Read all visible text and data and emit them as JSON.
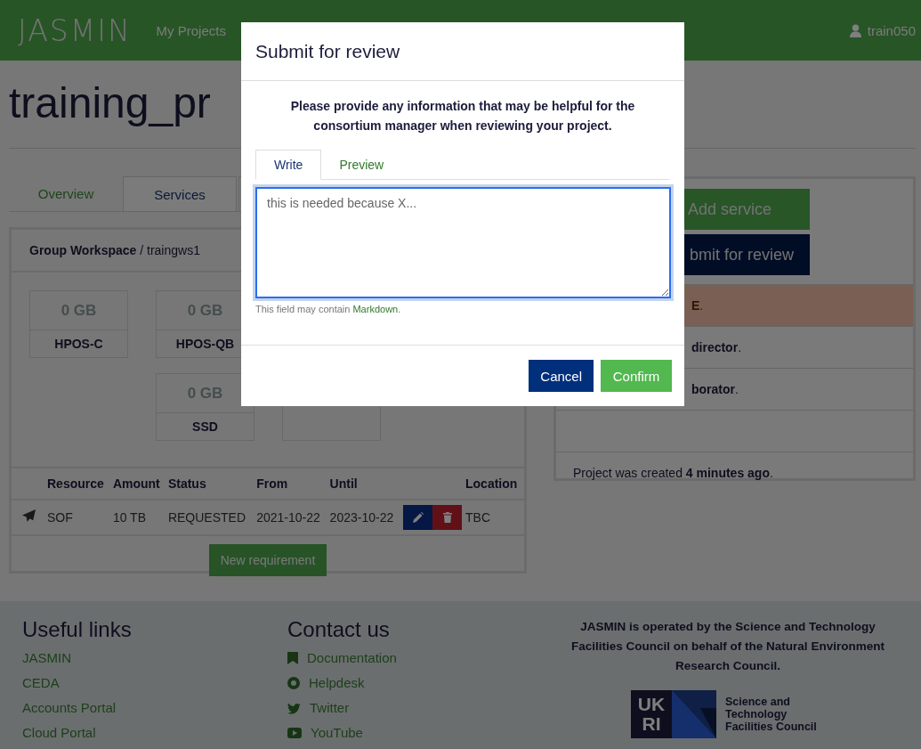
{
  "header": {
    "logo": "JASMIN",
    "nav": [
      {
        "label": "My Projects"
      }
    ],
    "user": "train050"
  },
  "project_title": "training_pr",
  "tabs": [
    {
      "label": "Overview",
      "selected": false
    },
    {
      "label": "Services",
      "selected": true
    }
  ],
  "service": {
    "heading": "**Group Workspace** / traingws1",
    "storage": [
      {
        "amount": "0 GB",
        "label": "HPOS-C"
      },
      {
        "amount": "0 GB",
        "label": "HPOS-QB"
      },
      {
        "amount": "0 GB",
        "label": "SSD"
      }
    ],
    "table": {
      "columns": [
        "Resource",
        "Amount",
        "Status",
        "From",
        "Until",
        "Location"
      ],
      "rows": [
        {
          "resource": "SOF",
          "amount": "10 TB",
          "status": "REQUESTED",
          "from": "2021-10-22",
          "until": "2023-10-22",
          "location": "TBC"
        }
      ]
    },
    "new_button": "New requirement"
  },
  "side_panel": {
    "buttons": [
      {
        "label": "Add service",
        "kind": "success"
      },
      {
        "label": "bmit for review",
        "kind": "primary"
      }
    ],
    "rows": [
      {
        "kind": "alert",
        "text": "**E**."
      },
      {
        "kind": "plain",
        "text": "**director**."
      },
      {
        "kind": "link",
        "text": "**borator**."
      },
      {
        "kind": "plain"
      },
      {
        "kind": "plain",
        "text": "Project was created **4 minutes ago**."
      }
    ]
  },
  "footer": {
    "links_title": "Useful links",
    "links": [
      "JASMIN",
      "CEDA",
      "Accounts Portal",
      "Cloud Portal"
    ],
    "contact_title": "Contact us",
    "contacts": [
      {
        "label": "Documentation",
        "kind": "docs"
      },
      {
        "label": "Helpdesk",
        "kind": "help"
      },
      {
        "label": "Twitter",
        "kind": "twitter"
      },
      {
        "label": "YouTube",
        "kind": "youtube"
      }
    ],
    "operator_text": "JASMIN is operated by the Science and Technology Facilities Council on behalf of the Natural Environment Research Council.",
    "logo": {
      "letters": [
        "UK",
        "RI"
      ],
      "caption": "Science and Technology Facilities Council"
    }
  },
  "modal": {
    "title": "Submit for review",
    "prompt": "Please provide any information that may be helpful for the consortium manager when reviewing your project.",
    "tabs": [
      {
        "label": "Write",
        "selected": true
      },
      {
        "label": "Preview",
        "selected": false
      }
    ],
    "value": "this is needed because X...",
    "hint": "This field may contain",
    "hint_link": "Markdown",
    "hint_end": ".",
    "buttons": [
      {
        "label": "Cancel",
        "kind": "primary"
      },
      {
        "label": "Confirm",
        "kind": "success"
      }
    ]
  }
}
